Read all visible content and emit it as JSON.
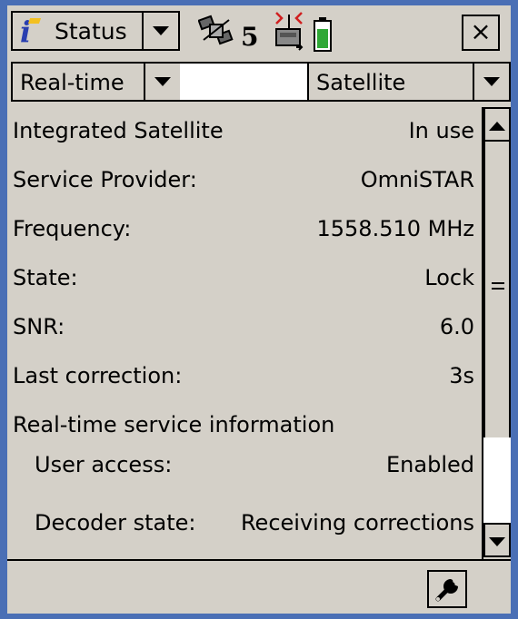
{
  "toolbar": {
    "status_label": "Status",
    "satellite_count": "5",
    "close_label": "×"
  },
  "row2": {
    "left_combo": "Real-time",
    "right_combo": "Satellite"
  },
  "details": [
    {
      "label": "Integrated Satellite",
      "value": "In use"
    },
    {
      "label": "Service Provider:",
      "value": "OmniSTAR"
    },
    {
      "label": "Frequency:",
      "value": "1558.510 MHz"
    },
    {
      "label": "State:",
      "value": "Lock"
    },
    {
      "label": "SNR:",
      "value": "6.0"
    },
    {
      "label": "Last correction:",
      "value": "3s"
    },
    {
      "label": "Real-time service information",
      "value": ""
    },
    {
      "label": "User access:",
      "value": "Enabled"
    },
    {
      "label": "Decoder state:",
      "value": "Receiving corrections"
    }
  ]
}
